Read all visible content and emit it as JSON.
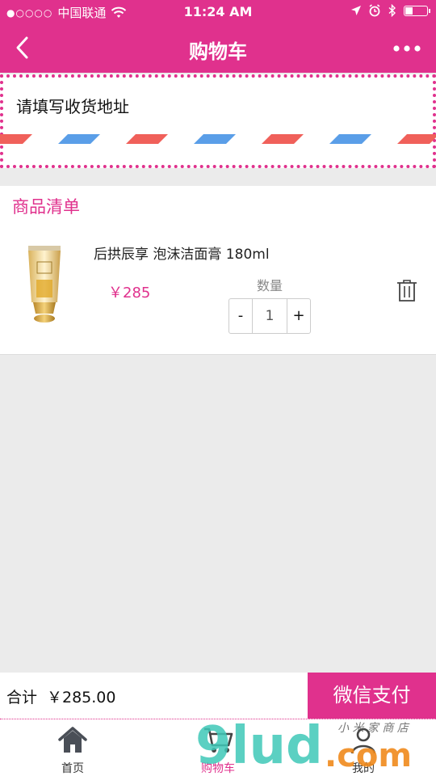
{
  "status_bar": {
    "signal": "●○○○○",
    "carrier": "中国联通",
    "time": "11:24 AM"
  },
  "nav": {
    "title": "购物车"
  },
  "address": {
    "placeholder": "请填写收货地址"
  },
  "list": {
    "section_title": "商品清单",
    "items": [
      {
        "name": "后拱辰享 泡沫洁面膏 180ml",
        "price": "￥285",
        "qty_label": "数量",
        "minus": "-",
        "qty": "1",
        "plus": "+"
      }
    ]
  },
  "footer": {
    "total_label": "合计",
    "total_value": "￥285.00",
    "pay_label": "微信支付"
  },
  "tabs": [
    {
      "label": "首页",
      "icon": "home-icon"
    },
    {
      "label": "购物车",
      "icon": "cart-icon"
    },
    {
      "label": "我的",
      "icon": "user-icon"
    }
  ],
  "watermark": {
    "brand": "9lud",
    "suffix": ".com",
    "script": "小 米 家 商 店"
  },
  "colors": {
    "accent": "#e0318d",
    "stripe_red": "#f0605a",
    "stripe_blue": "#5a9ee8"
  }
}
